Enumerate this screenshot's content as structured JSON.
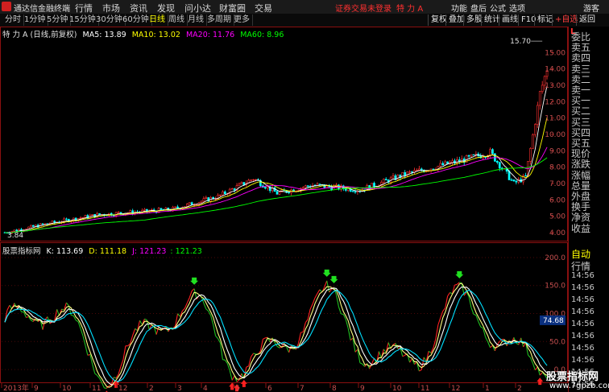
{
  "menubar": {
    "app_title": "通达信金融终端",
    "items": [
      "行情",
      "市场",
      "资讯",
      "发现",
      "问小达",
      "财富圈",
      "交易"
    ],
    "notice": "证券交易未登录",
    "stock": "特 力 A",
    "right_items": [
      "功能",
      "盘后",
      "公式",
      "选项",
      "游客"
    ]
  },
  "periodbar": {
    "tabs": [
      "分时",
      "1分钟",
      "5分钟",
      "15分钟",
      "30分钟",
      "60分钟",
      "日线",
      "周线",
      "月线",
      "多周期",
      "更多"
    ],
    "active": "日线",
    "tools": [
      "复权",
      "叠加",
      "多股",
      "统计",
      "画线",
      "F10",
      "标记",
      "+自选",
      "返回"
    ]
  },
  "price_info": {
    "title": "特 力 A (日线,前复权)",
    "ma5": "MA5: 13.89",
    "ma10": "MA10: 13.02",
    "ma20": "MA20: 11.76",
    "ma60": "MA60: 8.96"
  },
  "ind_info": {
    "name": "股票指标网",
    "k": "K: 113.69",
    "d": "D: 111.18",
    "j": "J: 121.23",
    "extra": ": 121.23"
  },
  "annotations": {
    "high": "15.70",
    "low": "3.84",
    "last": "74.68"
  },
  "price_axis": [
    "15.00",
    "14.00",
    "13.00",
    "12.00",
    "11.00",
    "10.00",
    "9.00",
    "8.00",
    "7.00",
    "6.00",
    "5.00",
    "4.00"
  ],
  "ind_axis": [
    "200.0",
    "150.0",
    "100.0",
    "50.0",
    "0.0"
  ],
  "time_axis": [
    "2013年",
    "9",
    "10",
    "11",
    "12",
    "2",
    "3",
    "4",
    "5",
    "6",
    "7",
    "8",
    "9",
    "10",
    "11",
    "12",
    "1",
    "2"
  ],
  "right_panel": {
    "header": "L",
    "top_items": [
      "委比",
      "卖五",
      "卖四",
      "卖三",
      "卖二",
      "卖一",
      "买一",
      "买二",
      "买三",
      "买四",
      "买五",
      "现价",
      "涨跌",
      "涨幅",
      "总量",
      "外盘",
      "换手",
      "净资",
      "收益"
    ],
    "auto": "自动",
    "quotes": "行情",
    "times": [
      "14:56",
      "14:56",
      "14:56",
      "14:56",
      "14:56",
      "14:56",
      "14:56",
      "14:56",
      "14:56",
      "14:56"
    ]
  },
  "watermark": {
    "line1": "股票指标网",
    "line2": "www.7gpzb.com"
  },
  "colors": {
    "up": "#ff3030",
    "down": "#00ffff",
    "ma5": "#ffffff",
    "ma10": "#ffff00",
    "ma20": "#ff00ff",
    "ma60": "#00ff00"
  }
}
